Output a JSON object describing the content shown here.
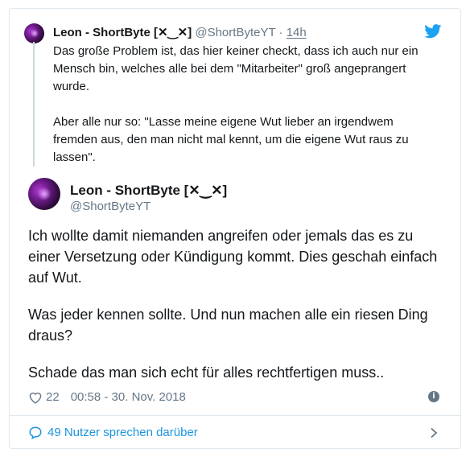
{
  "quoted_tweet": {
    "name": "Leon - ShortByte [✕‿✕]",
    "handle": "@ShortByteYT",
    "separator": "·",
    "time": "14h",
    "paragraphs": [
      "Das große Problem ist, das hier keiner checkt, dass ich auch nur ein Mensch bin, welches alle bei dem \"Mitarbeiter\" groß angeprangert wurde.",
      "Aber alle nur so: \"Lasse meine eigene Wut lieber an irgendwem fremden aus, den man nicht mal kennt, um die eigene Wut raus zu lassen\"."
    ]
  },
  "main_tweet": {
    "name": "Leon - ShortByte [✕‿✕]",
    "handle": "@ShortByteYT",
    "paragraphs": [
      "Ich wollte damit niemanden angreifen oder jemals das es zu einer Versetzung oder Kündigung kommt. Dies geschah einfach auf Wut.",
      "Was jeder kennen sollte. Und nun machen alle ein riesen Ding draus?",
      "Schade das man sich echt für alles rechtfertigen muss.."
    ],
    "likes": "22",
    "timestamp": "00:58 - 30. Nov. 2018"
  },
  "footer": {
    "conversation_label": "49 Nutzer sprechen darüber"
  },
  "icons": {
    "brand": "twitter-bird-icon",
    "like": "heart-icon",
    "info": "info-icon",
    "reply": "speech-bubble-icon",
    "more": "chevron-right-icon"
  },
  "colors": {
    "accent": "#1b95e0",
    "muted": "#657786",
    "text": "#14171a",
    "border": "#e1e8ed"
  }
}
